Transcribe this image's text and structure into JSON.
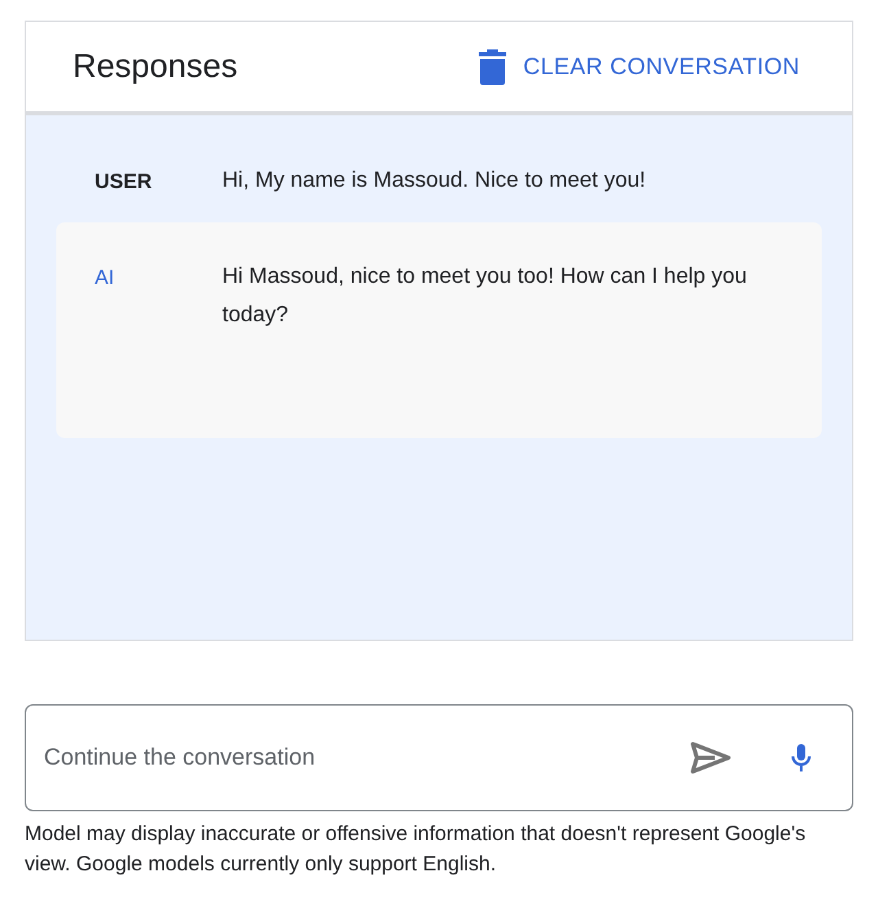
{
  "header": {
    "title": "Responses",
    "clear_button": "CLEAR CONVERSATION"
  },
  "messages": [
    {
      "kind": "user",
      "speaker": "USER",
      "text": "Hi, My name is Massoud. Nice to meet you!"
    },
    {
      "kind": "ai",
      "speaker": "AI",
      "text": "Hi Massoud, nice to meet you too! How can I help you today?"
    }
  ],
  "input": {
    "placeholder": "Continue the conversation"
  },
  "disclaimer": "Model may display inaccurate or offensive information that doesn't represent Google's view. Google models currently only support English."
}
